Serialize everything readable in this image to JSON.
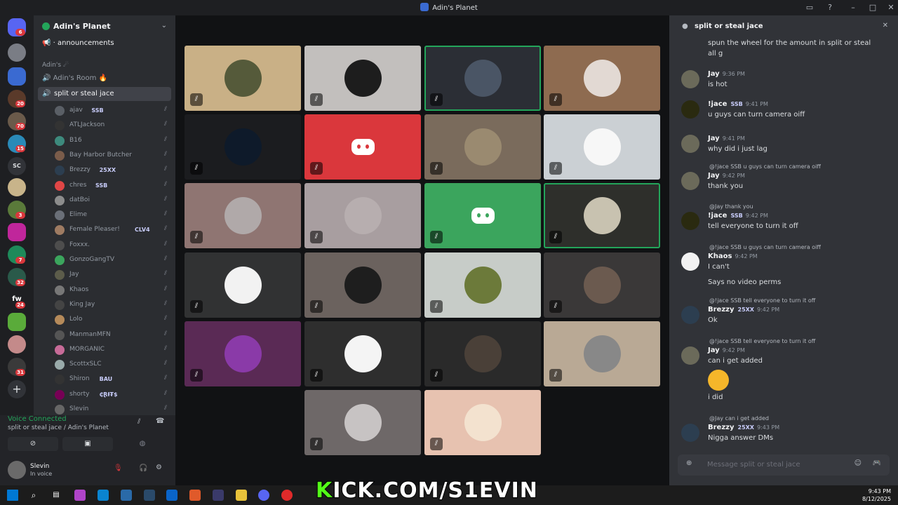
{
  "window": {
    "title": "Adin's Planet"
  },
  "server": {
    "name": "Adin's Planet",
    "category": "Adin's ☄",
    "channel_announcements": "announcements",
    "channel_room": "Adin's Room 🔥",
    "voice_channel": "split or steal jace"
  },
  "server_rail": {
    "sc_label": "SC",
    "fw_label": "fw",
    "badges": [
      "6",
      "20",
      "70",
      "15",
      "3",
      "7",
      "32",
      "24",
      "31"
    ]
  },
  "voice_users": [
    {
      "name": "ajav",
      "tag": "SSB",
      "color": "#5a5f66"
    },
    {
      "name": "ATLJackson",
      "tag": "",
      "color": "#333"
    },
    {
      "name": "B16",
      "tag": "",
      "color": "#3d8a7d"
    },
    {
      "name": "Bay Harbor Butcher",
      "tag": "",
      "color": "#7a5c4a"
    },
    {
      "name": "Brezzy",
      "tag": "25XX",
      "color": "#2c3e50"
    },
    {
      "name": "chres",
      "tag": "SSB",
      "color": "#e04646"
    },
    {
      "name": "datBoi",
      "tag": "",
      "color": "#8c8c8c"
    },
    {
      "name": "Elime",
      "tag": "",
      "color": "#6a6f78"
    },
    {
      "name": "Female Pleaser!",
      "tag": "CLV4",
      "color": "#9e7b62"
    },
    {
      "name": "Foxxx.",
      "tag": "",
      "color": "#4d4d4d"
    },
    {
      "name": "GonzoGangTV",
      "tag": "",
      "color": "#3ba55d"
    },
    {
      "name": "Jay",
      "tag": "",
      "color": "#5c5c4a"
    },
    {
      "name": "Khaos",
      "tag": "",
      "color": "#777"
    },
    {
      "name": "King Jay",
      "tag": "",
      "color": "#444"
    },
    {
      "name": "Lolo",
      "tag": "",
      "color": "#b58a5a"
    },
    {
      "name": "ManmanMFN",
      "tag": "",
      "color": "#555"
    },
    {
      "name": "MORGANIC",
      "tag": "",
      "color": "#c76b98"
    },
    {
      "name": "ScottxSLC",
      "tag": "",
      "color": "#9aa"
    },
    {
      "name": "Shiron",
      "tag": "BAU",
      "color": "#333"
    },
    {
      "name": "shorty",
      "tag": "₵ⱤƗ₮$",
      "color": "#705"
    },
    {
      "name": "Slevin",
      "tag": "",
      "color": "#666"
    }
  ],
  "voice_status": {
    "label": "Voice Connected",
    "location": "split or steal jace / Adin's Planet"
  },
  "user_panel": {
    "name": "Slevin",
    "status": "In voice"
  },
  "tiles": [
    {
      "bg": "#c9b086",
      "circle": "#555a3a",
      "speaking": false
    },
    {
      "bg": "#c2bfbd",
      "circle": "#1d1d1d",
      "speaking": false
    },
    {
      "bg": "#2b2e35",
      "circle": "#4a5565",
      "speaking": true
    },
    {
      "bg": "#8e6b50",
      "circle": "#e2d9d3",
      "speaking": false
    },
    {
      "bg": "#1b1c1f",
      "circle": "#0e1a2a",
      "speaking": false
    },
    {
      "bg": "#da373c",
      "circle": "discord",
      "speaking": false
    },
    {
      "bg": "#7a6b5c",
      "circle": "#9a8a70",
      "speaking": false
    },
    {
      "bg": "#cbd0d4",
      "circle": "#f7f7f7",
      "speaking": false
    },
    {
      "bg": "#8f7572",
      "circle": "#b0a9a9",
      "speaking": false
    },
    {
      "bg": "#a89ea0",
      "circle": "#b7aeaf",
      "speaking": false
    },
    {
      "bg": "#3ba55d",
      "circle": "discord",
      "speaking": false
    },
    {
      "bg": "#2e2f2b",
      "circle": "#c8c2b0",
      "speaking": true
    },
    {
      "bg": "#313233",
      "circle": "#f2f2f2",
      "speaking": false
    },
    {
      "bg": "#6b625e",
      "circle": "#1e1e1e",
      "speaking": false
    },
    {
      "bg": "#c7ccc8",
      "circle": "#6c7a3a",
      "speaking": false
    },
    {
      "bg": "#3a3838",
      "circle": "#6b5a4f",
      "speaking": false
    },
    {
      "bg": "#5a2a55",
      "circle": "#8a3aa8",
      "speaking": false
    },
    {
      "bg": "#2e2e2e",
      "circle": "#f4f4f4",
      "speaking": false
    },
    {
      "bg": "#2a2a2a",
      "circle": "#4a4038",
      "speaking": false
    },
    {
      "bg": "#b9a995",
      "circle": "#888",
      "speaking": false
    },
    {
      "bg": "#6e6868",
      "circle": "#c7c3c3",
      "speaking": false
    },
    {
      "bg": "#e7c2b0",
      "circle": "#f3e2cf",
      "speaking": false
    }
  ],
  "chat": {
    "title": "split or steal jace",
    "input_placeholder": "Message split or steal jace",
    "top_lines": [
      "spun the wheel for the amount in split or steal",
      "all g"
    ],
    "messages": [
      {
        "user": "Jay",
        "time": "9:36 PM",
        "text": "is hot",
        "reply": ""
      },
      {
        "user": "!jace",
        "tag": "SSB",
        "time": "9:41 PM",
        "text": "u guys can turn camera oiff",
        "reply": ""
      },
      {
        "user": "Jay",
        "time": "9:41 PM",
        "text": "why did i just lag",
        "reply": ""
      },
      {
        "user": "Jay",
        "time": "9:42 PM",
        "text": "thank you",
        "reply": "@!jace  SSB  u guys can turn camera oiff"
      },
      {
        "user": "!jace",
        "tag": "SSB",
        "time": "9:42 PM",
        "text": "tell everyone to turn it off",
        "reply": "@Jay thank you"
      },
      {
        "user": "Khaos",
        "time": "9:42 PM",
        "text": "I can't",
        "text2": "Says no video perms",
        "reply": "@!jace  SSB  u guys can turn camera oiff"
      },
      {
        "user": "Brezzy",
        "tag": "25XX",
        "time": "9:42 PM",
        "text": "Ok",
        "reply": "@!jace  SSB  tell everyone to turn it off"
      },
      {
        "user": "Jay",
        "time": "9:42 PM",
        "text": "can  i get added",
        "text2": "i did",
        "reply": "@!jace  SSB  tell everyone to turn it off"
      },
      {
        "user": "Brezzy",
        "tag": "25XX",
        "time": "9:43 PM",
        "text": "Nigga answer DMs",
        "reply": "@Jay can  i get added"
      }
    ]
  },
  "taskbar": {
    "time": "9:43 PM",
    "date": "8/12/2025"
  },
  "overlay": {
    "kick_k": "K",
    "kick_rest": "ICK.COM/S1EVIN"
  }
}
